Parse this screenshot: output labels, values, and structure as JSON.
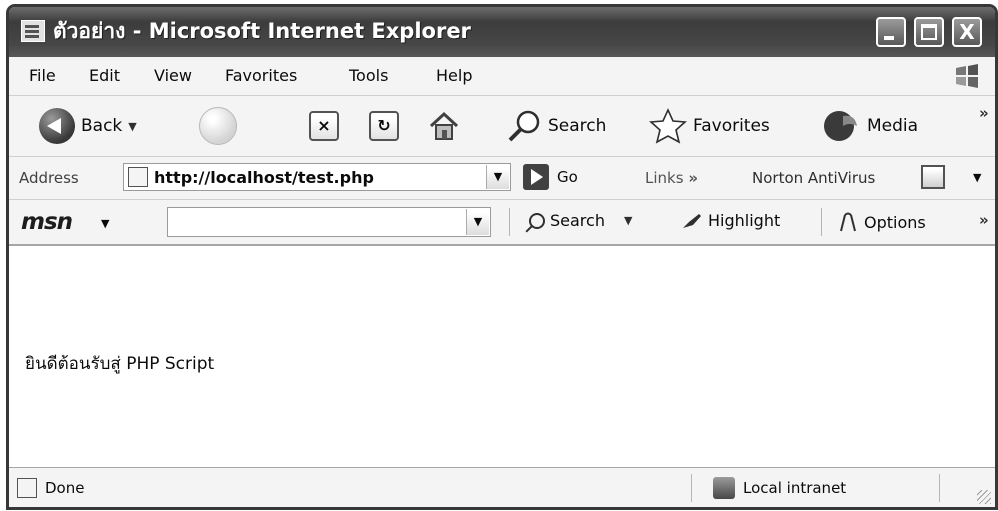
{
  "window": {
    "title": "ตัวอย่าง - Microsoft Internet Explorer",
    "close_glyph": "X"
  },
  "menu": {
    "items": [
      "File",
      "Edit",
      "View",
      "Favorites",
      "Tools",
      "Help"
    ]
  },
  "toolbar": {
    "back_label": "Back",
    "search_label": "Search",
    "favorites_label": "Favorites",
    "media_label": "Media",
    "stop_glyph": "×",
    "refresh_glyph": "↻",
    "chevron": "»"
  },
  "address": {
    "label": "Address",
    "url": "http://localhost/test.php",
    "go_label": "Go",
    "links_label": "Links",
    "links_chevron": "»",
    "norton_label": "Norton AntiVirus"
  },
  "msn": {
    "logo": "msn",
    "search_value": "",
    "search_label": "Search",
    "highlight_label": "Highlight",
    "options_label": "Options",
    "chevron": "»"
  },
  "page": {
    "text": "ยินดีต้อนรับสู่ PHP Script"
  },
  "status": {
    "text": "Done",
    "zone": "Local intranet"
  },
  "colors": {
    "titlebar": "#4a4a4a",
    "chrome": "#f1efe6"
  },
  "icons": [
    "app-icon",
    "minimize-icon",
    "maximize-icon",
    "close-icon",
    "windows-logo-icon",
    "back-arrow-icon",
    "forward-arrow-icon",
    "stop-icon",
    "refresh-icon",
    "home-icon",
    "search-icon",
    "favorites-star-icon",
    "media-icon",
    "page-icon",
    "go-arrow-icon",
    "norton-icon",
    "highlighter-icon",
    "options-icon",
    "intranet-icon"
  ]
}
